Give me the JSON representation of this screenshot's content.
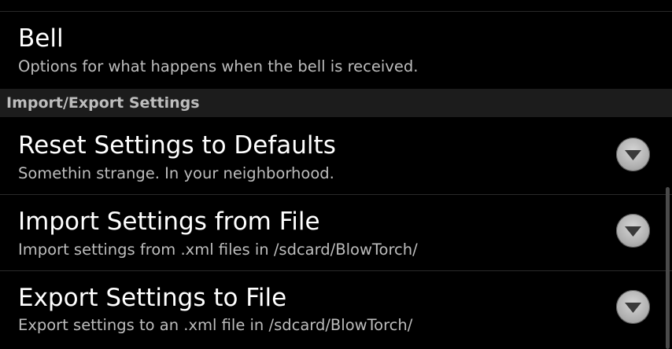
{
  "preferences": {
    "bell": {
      "title": "Bell",
      "summary": "Options for what happens when the bell is received."
    },
    "category": {
      "label": "Import/Export Settings"
    },
    "reset": {
      "title": "Reset Settings to Defaults",
      "summary": "Somethin strange. In your neighborhood.",
      "icon": "chevron-down-icon"
    },
    "import": {
      "title": "Import Settings from File",
      "summary": "Import settings from .xml files in /sdcard/BlowTorch/",
      "icon": "chevron-down-icon"
    },
    "export": {
      "title": "Export Settings to File",
      "summary": "Export settings to an .xml file in /sdcard/BlowTorch/",
      "icon": "chevron-down-icon"
    }
  },
  "colors": {
    "background": "#000000",
    "title": "#ffffff",
    "summary": "#bdbdbd",
    "category_bg": "#1c1c1c",
    "divider": "#2a2a2a"
  }
}
